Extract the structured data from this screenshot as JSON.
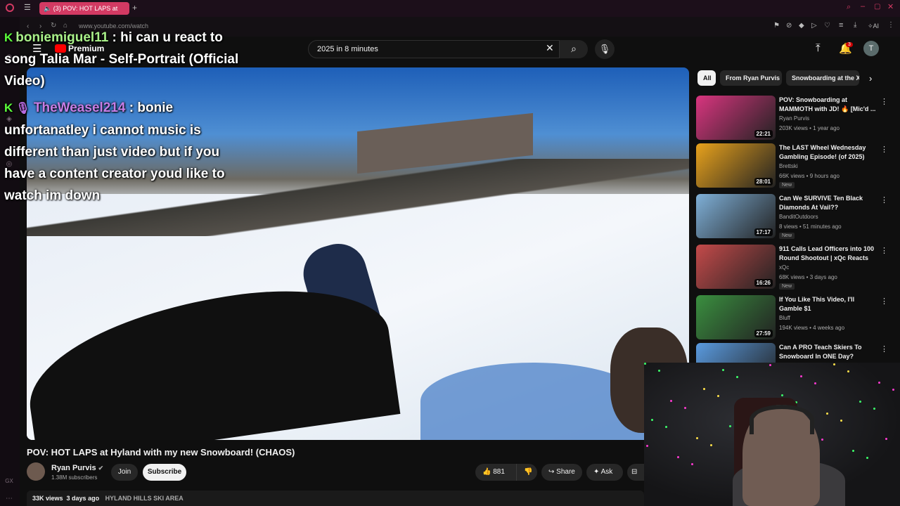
{
  "browser": {
    "tab_title": "(3) POV: HOT LAPS at",
    "url": "www.youtube.com/watch",
    "ai_label": "AI"
  },
  "header": {
    "premium_label": "Premium",
    "search_value": "2025 in 8 minutes",
    "notification_count": "3",
    "avatar_letter": "T"
  },
  "chat": [
    {
      "user": "boniemiguel11",
      "text": ": hi can u react to song Talia Mar - Self-Portrait (Official Video)",
      "badge": "K"
    },
    {
      "user": "TheWeasel214",
      "text": ": bonie unfortanatley i cannot music is different than just video but if you have a content creator youd like to watch im down",
      "badge": "K"
    }
  ],
  "video": {
    "title": "POV: HOT LAPS at Hyland with my new Snowboard! (CHAOS)",
    "channel": "Ryan Purvis",
    "subscribers": "1.38M subscribers",
    "join_label": "Join",
    "subscribe_label": "Subscribe",
    "likes": "881",
    "share_label": "Share",
    "ask_label": "Ask",
    "views": "33K views",
    "age": "3 days ago",
    "location": "HYLAND HILLS SKI AREA"
  },
  "chips": [
    "All",
    "From Ryan Purvis",
    "Snowboarding at the X"
  ],
  "recommendations": [
    {
      "title": "POV: Snowboarding at MAMMOTH with JD! 🔥 [Mic'd ...",
      "channel": "Ryan Purvis",
      "meta": "203K views • 1 year ago",
      "duration": "22:21",
      "badge": "",
      "color": "#d9357f"
    },
    {
      "title": "The LAST Wheel Wednesday Gambling Episode! (of 2025)",
      "channel": "Brettski",
      "meta": "66K views • 9 hours ago",
      "duration": "28:01",
      "badge": "New",
      "color": "#e8a21c"
    },
    {
      "title": "Can We SURVIVE Ten Black Diamonds At Vail??",
      "channel": "BanditOutdoors",
      "meta": "8 views • 51 minutes ago",
      "duration": "17:17",
      "badge": "New",
      "color": "#7fb0d8"
    },
    {
      "title": "911 Calls Lead Officers into 100 Round Shootout | xQc Reacts",
      "channel": "xQc",
      "meta": "68K views • 3 days ago",
      "duration": "16:26",
      "badge": "New",
      "color": "#c44a4a"
    },
    {
      "title": "If You Like This Video, I'll Gamble $1",
      "channel": "Bluff",
      "meta": "194K views • 4 weeks ago",
      "duration": "27:59",
      "badge": "",
      "color": "#3a8f3f"
    },
    {
      "title": "Can A PRO Teach Skiers To Snowboard In ONE Day?",
      "channel": "",
      "meta": "",
      "duration": "",
      "badge": "",
      "color": "#5a9be0"
    }
  ]
}
